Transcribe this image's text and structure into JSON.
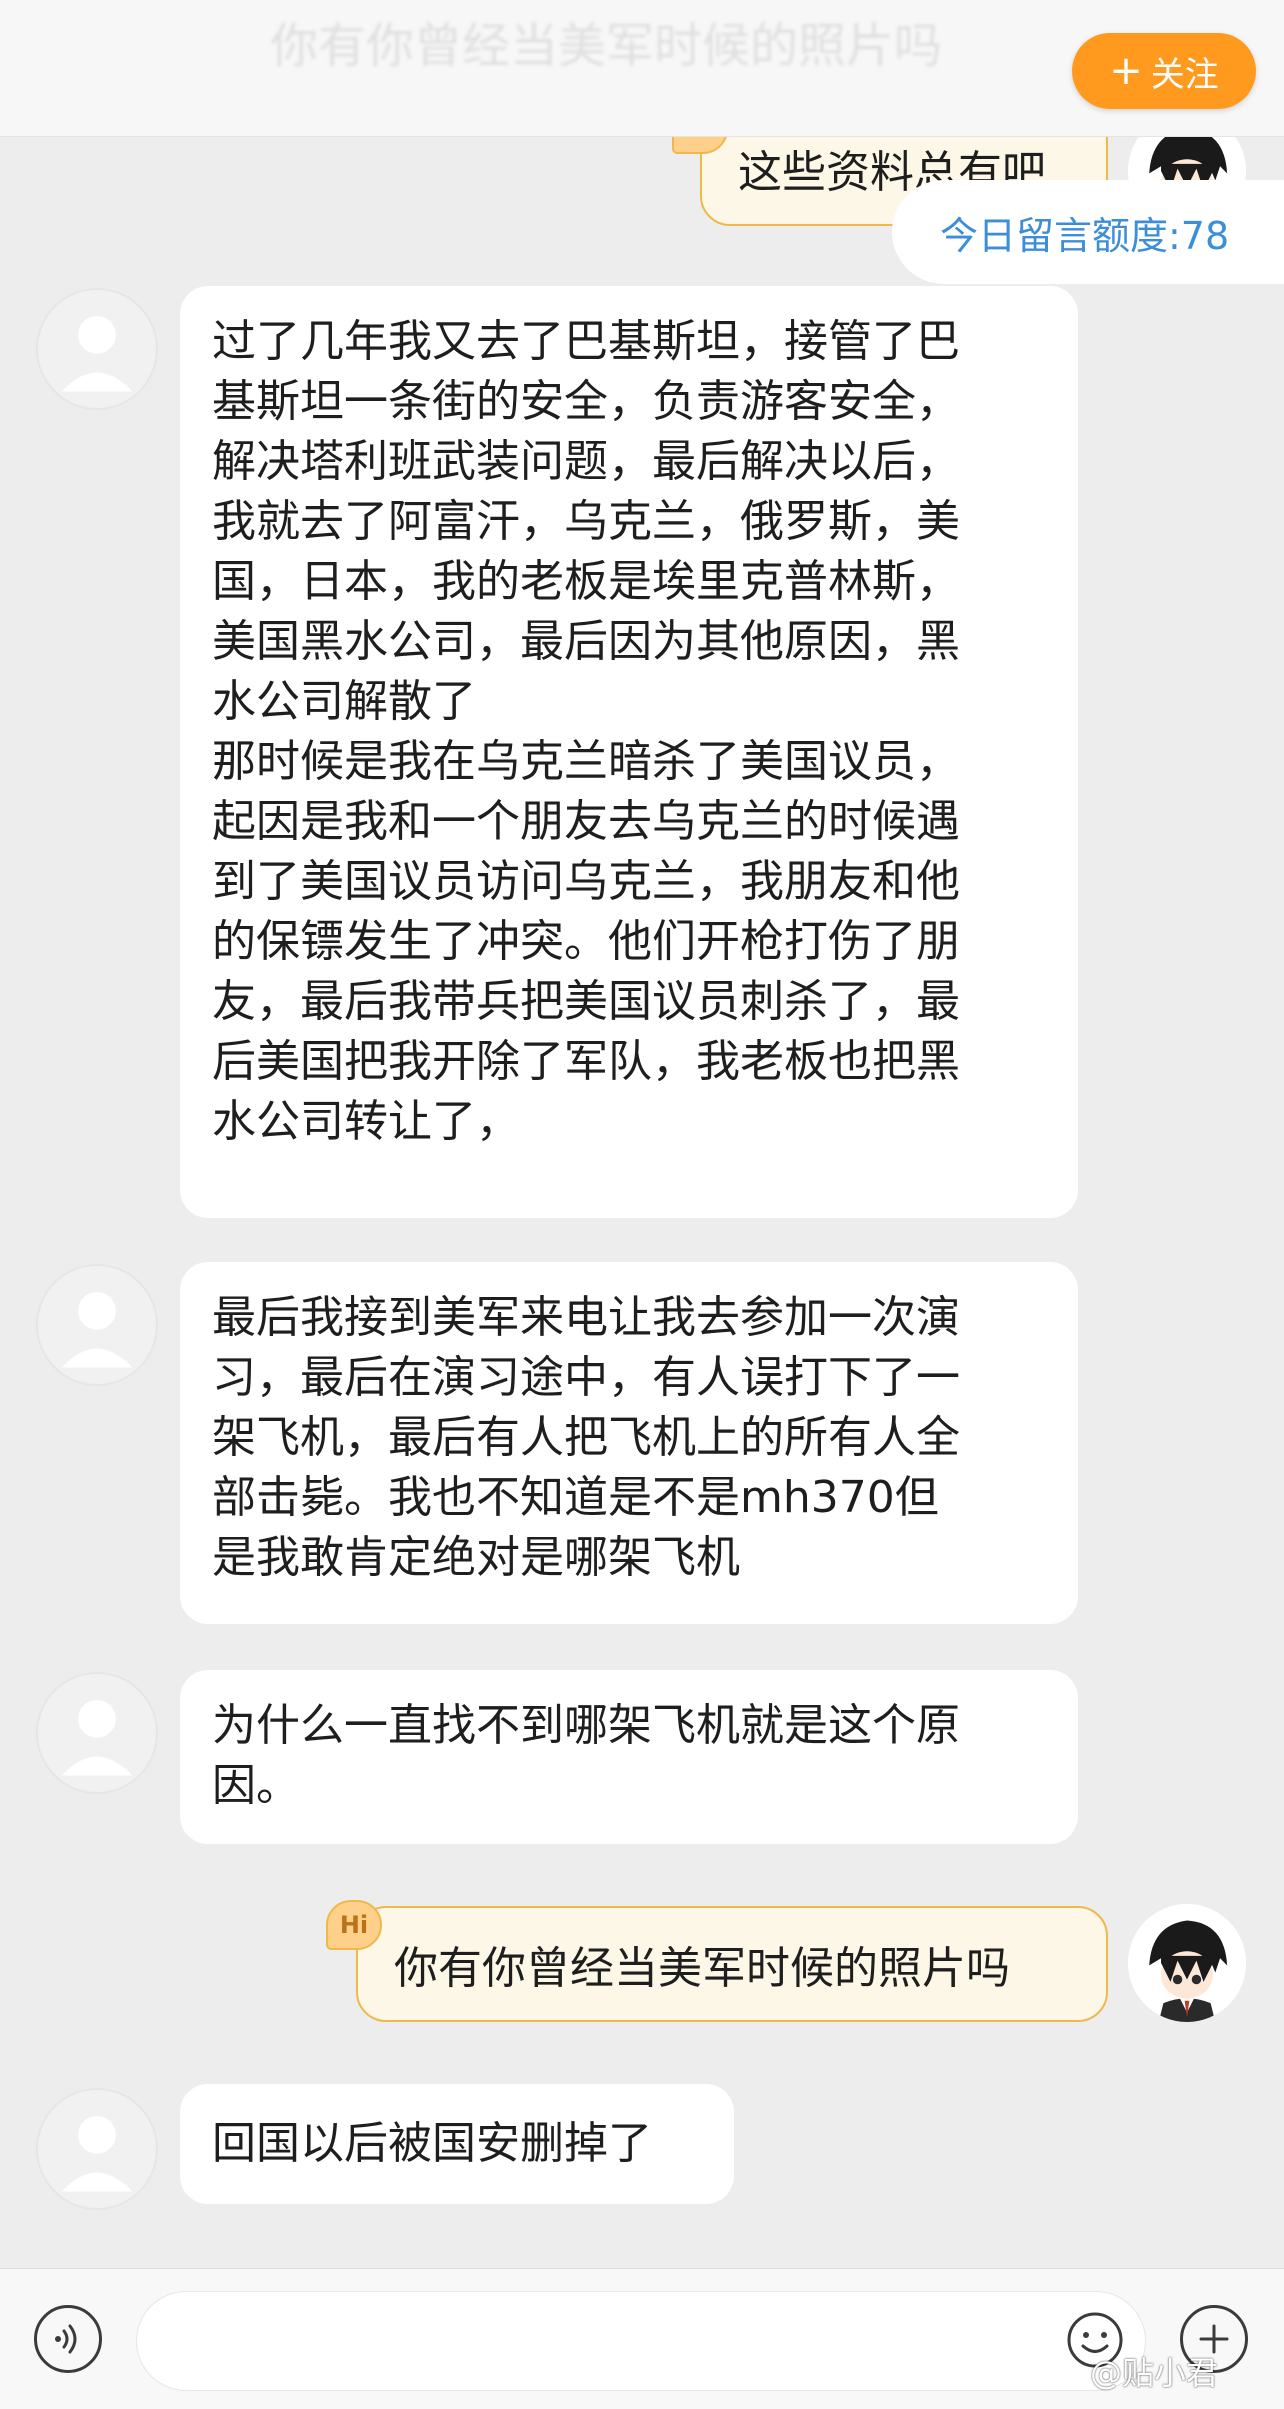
{
  "header": {
    "title": "你有你曾经当美军时候的照片吗",
    "follow_label": "关注"
  },
  "quota": {
    "text": "今日留言额度:78"
  },
  "messages": [
    {
      "side": "out",
      "text": "这些资料总有吧",
      "badge": "Hi"
    },
    {
      "side": "in",
      "text": "过了几年我又去了巴基斯坦，接管了巴\n基斯坦一条街的安全，负责游客安全，\n解决塔利班武装问题，最后解决以后，\n我就去了阿富汗，乌克兰，俄罗斯，美\n国，日本，我的老板是埃里克普林斯，\n美国黑水公司，最后因为其他原因，黑\n水公司解散了\n那时候是我在乌克兰暗杀了美国议员，\n起因是我和一个朋友去乌克兰的时候遇\n到了美国议员访问乌克兰，我朋友和他\n的保镖发生了冲突。他们开枪打伤了朋\n友，最后我带兵把美国议员刺杀了，最\n后美国把我开除了军队，我老板也把黑\n水公司转让了，"
    },
    {
      "side": "in",
      "text": "最后我接到美军来电让我去参加一次演\n习，最后在演习途中，有人误打下了一\n架飞机，最后有人把飞机上的所有人全\n部击毙。我也不知道是不是mh370但\n是我敢肯定绝对是哪架飞机"
    },
    {
      "side": "in",
      "text": "为什么一直找不到哪架飞机就是这个原\n因。"
    },
    {
      "side": "out",
      "text": "你有你曾经当美军时候的照片吗",
      "badge": "Hi"
    },
    {
      "side": "in",
      "text": "回国以后被国安删掉了"
    }
  ],
  "input": {
    "placeholder": ""
  },
  "watermark": "@贴小君",
  "colors": {
    "background": "#ededed",
    "follow_button": "#ff9a1f",
    "quota_text": "#3c8ed9",
    "outgoing_bubble": "#fdf7e7",
    "outgoing_border": "#f0b84a"
  },
  "icons": {
    "voice": "voice-icon",
    "emoji": "emoji-icon",
    "plus": "plus-icon",
    "avatar_default": "default-avatar-icon",
    "avatar_user": "user-avatar-icon",
    "hi_badge": "hi-badge-icon"
  }
}
